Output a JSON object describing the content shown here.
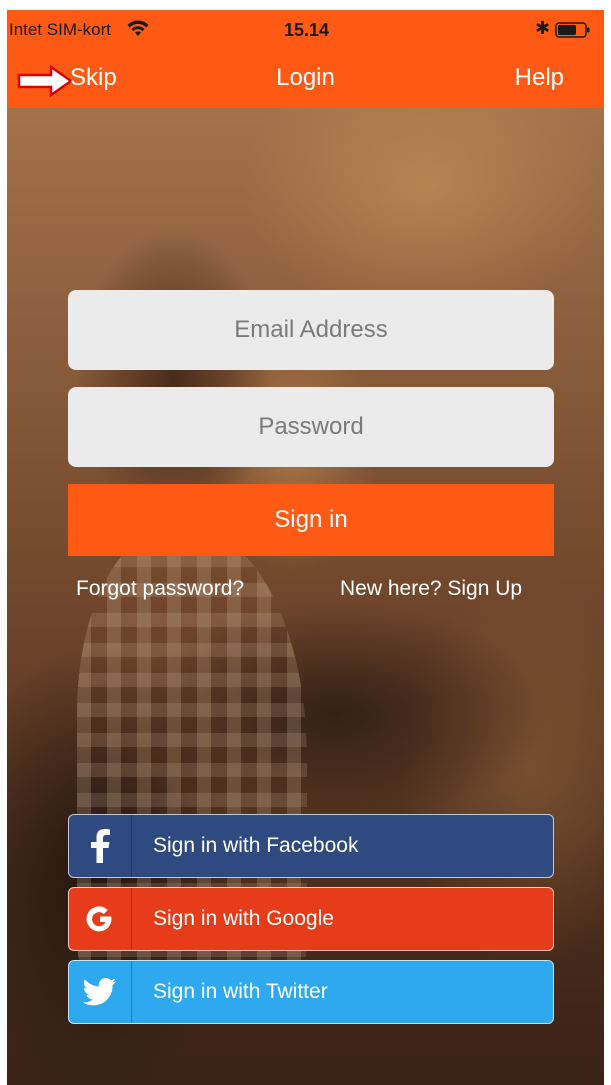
{
  "status_bar": {
    "carrier": "Intet SIM-kort",
    "time": "15.14"
  },
  "nav": {
    "skip_label": "Skip",
    "title": "Login",
    "help_label": "Help"
  },
  "form": {
    "email_placeholder": "Email Address",
    "password_placeholder": "Password",
    "signin_label": "Sign in",
    "forgot_label": "Forgot password?",
    "signup_label": "New here? Sign Up"
  },
  "social": {
    "facebook_label": "Sign in with Facebook",
    "google_label": "Sign in with Google",
    "twitter_label": "Sign in with Twitter"
  },
  "colors": {
    "accent": "#ff5a14",
    "facebook": "#2f4a80",
    "google": "#e63c1a",
    "twitter": "#2ea8ef"
  }
}
